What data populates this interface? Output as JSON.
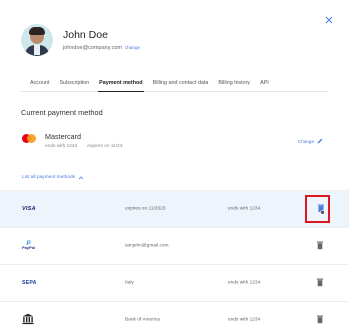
{
  "profile": {
    "name": "John Doe",
    "email": "johndoe@company.com",
    "change_link": "change"
  },
  "tabs": [
    {
      "label": "Account",
      "active": false
    },
    {
      "label": "Subscription",
      "active": false
    },
    {
      "label": "Payment method",
      "active": true
    },
    {
      "label": "Billing and contact data",
      "active": false
    },
    {
      "label": "Billing history",
      "active": false
    },
    {
      "label": "API",
      "active": false
    }
  ],
  "section_title": "Current payment method",
  "current_method": {
    "brand": "Mastercard",
    "ends_with": "ends with 1234",
    "expires": "expires on 11/23",
    "change_label": "Change"
  },
  "list_toggle": {
    "label": "List all payment methods",
    "icon": "chevron-up-icon"
  },
  "methods": [
    {
      "logo": "VISA",
      "col2": "expires on 11/2023",
      "col3": "ends with 1234",
      "selected": true
    },
    {
      "logo": "PayPal",
      "col2": "iamjohn@gmail.com",
      "col3": "",
      "selected": false
    },
    {
      "logo": "SEPA",
      "col2": "Italy",
      "col3": "ends with 1234",
      "selected": false
    },
    {
      "logo": "bank",
      "col2": "Bank of America",
      "col3": "ends with 1234",
      "selected": false
    }
  ],
  "colors": {
    "accent": "#4a7be0",
    "highlight": "#e0161e",
    "selected_row": "#eef4fb"
  }
}
